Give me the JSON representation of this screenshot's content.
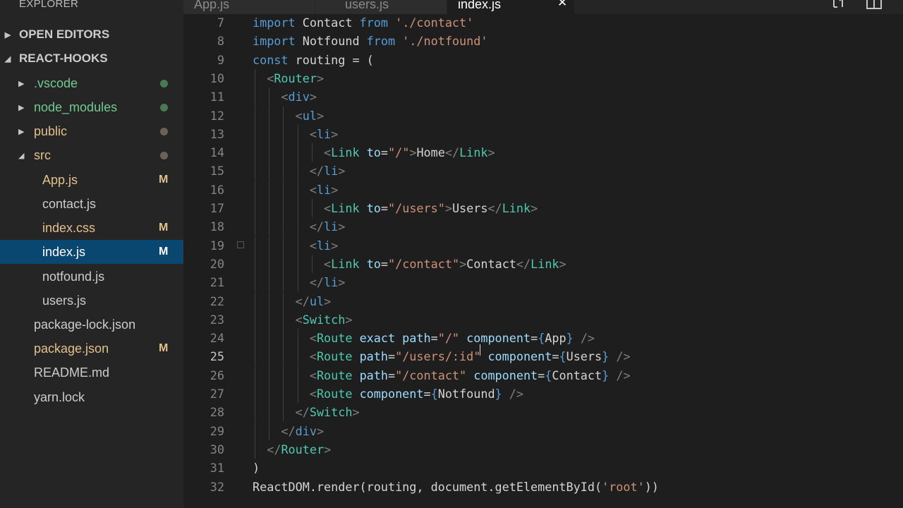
{
  "explorer": {
    "title": "EXPLORER",
    "open_editors": "OPEN EDITORS",
    "project": "REACT-HOOKS",
    "items": [
      {
        "name": ".vscode",
        "kind": "folder",
        "color": "#73c991",
        "status_dot": "#4a7a52"
      },
      {
        "name": "node_modules",
        "kind": "folder",
        "color": "#73c991",
        "status_dot": "#4a7a52"
      },
      {
        "name": "public",
        "kind": "folder",
        "color": "#e2c08d",
        "status_dot": "#6b6256"
      },
      {
        "name": "src",
        "kind": "folder-open",
        "color": "#e2c08d",
        "status_dot": "#6b6256"
      },
      {
        "name": "App.js",
        "kind": "file",
        "color": "#e2c08d",
        "badge": "M"
      },
      {
        "name": "contact.js",
        "kind": "file",
        "color": "#cccccc"
      },
      {
        "name": "index.css",
        "kind": "file",
        "color": "#e2c08d",
        "badge": "M"
      },
      {
        "name": "index.js",
        "kind": "file",
        "color": "#ffffff",
        "badge": "M",
        "selected": true
      },
      {
        "name": "notfound.js",
        "kind": "file",
        "color": "#cccccc"
      },
      {
        "name": "users.js",
        "kind": "file",
        "color": "#cccccc"
      },
      {
        "name": "package-lock.json",
        "kind": "root-file",
        "color": "#cccccc"
      },
      {
        "name": "package.json",
        "kind": "root-file",
        "color": "#e2c08d",
        "badge": "M"
      },
      {
        "name": "README.md",
        "kind": "root-file",
        "color": "#cccccc"
      },
      {
        "name": "yarn.lock",
        "kind": "root-file",
        "color": "#cccccc"
      }
    ]
  },
  "tabs": [
    {
      "label": "App.js",
      "active": false
    },
    {
      "label": "users.js",
      "active": false
    },
    {
      "label": "index.js",
      "active": true,
      "close": "✕"
    }
  ],
  "toolbar_icons": [
    "split-compare-icon",
    "split-editor-icon"
  ],
  "editor": {
    "current_line": 25,
    "lines": [
      {
        "n": "7",
        "tokens": [
          [
            "kw",
            "import "
          ],
          [
            "id",
            "Contact "
          ],
          [
            "kw",
            "from "
          ],
          [
            "str",
            "'./contact'"
          ]
        ]
      },
      {
        "n": "8",
        "tokens": [
          [
            "kw",
            "import "
          ],
          [
            "id",
            "Notfound "
          ],
          [
            "kw",
            "from "
          ],
          [
            "str",
            "'./notfound'"
          ]
        ]
      },
      {
        "n": "9",
        "tokens": [
          [
            "kw",
            "const "
          ],
          [
            "id",
            "routing = ("
          ]
        ]
      },
      {
        "n": "10",
        "tokens": [
          [
            "id",
            "  "
          ],
          [
            "punc",
            "<"
          ],
          [
            "tag",
            "Router"
          ],
          [
            "punc",
            ">"
          ]
        ]
      },
      {
        "n": "11",
        "tokens": [
          [
            "id",
            "    "
          ],
          [
            "punc",
            "<"
          ],
          [
            "tag",
            "div"
          ],
          [
            "punc",
            ">"
          ]
        ]
      },
      {
        "n": "12",
        "tokens": [
          [
            "id",
            "      "
          ],
          [
            "punc",
            "<"
          ],
          [
            "tag",
            "ul"
          ],
          [
            "punc",
            ">"
          ]
        ]
      },
      {
        "n": "13",
        "tokens": [
          [
            "id",
            "        "
          ],
          [
            "punc",
            "<"
          ],
          [
            "tag",
            "li"
          ],
          [
            "punc",
            ">"
          ]
        ]
      },
      {
        "n": "14",
        "tokens": [
          [
            "id",
            "          "
          ],
          [
            "punc",
            "<"
          ],
          [
            "tag",
            "Link "
          ],
          [
            "attr",
            "to"
          ],
          [
            "id",
            "="
          ],
          [
            "str",
            "\"/\""
          ],
          [
            "punc",
            ">"
          ],
          [
            "id",
            "Home"
          ],
          [
            "punc",
            "</"
          ],
          [
            "tag",
            "Link"
          ],
          [
            "punc",
            ">"
          ]
        ]
      },
      {
        "n": "15",
        "tokens": [
          [
            "id",
            "        "
          ],
          [
            "punc",
            "</"
          ],
          [
            "tag",
            "li"
          ],
          [
            "punc",
            ">"
          ]
        ]
      },
      {
        "n": "16",
        "tokens": [
          [
            "id",
            "        "
          ],
          [
            "punc",
            "<"
          ],
          [
            "tag",
            "li"
          ],
          [
            "punc",
            ">"
          ]
        ]
      },
      {
        "n": "17",
        "tokens": [
          [
            "id",
            "          "
          ],
          [
            "punc",
            "<"
          ],
          [
            "tag",
            "Link "
          ],
          [
            "attr",
            "to"
          ],
          [
            "id",
            "="
          ],
          [
            "str",
            "\"/users\""
          ],
          [
            "punc",
            ">"
          ],
          [
            "id",
            "Users"
          ],
          [
            "punc",
            "</"
          ],
          [
            "tag",
            "Link"
          ],
          [
            "punc",
            ">"
          ]
        ]
      },
      {
        "n": "18",
        "tokens": [
          [
            "id",
            "        "
          ],
          [
            "punc",
            "</"
          ],
          [
            "tag",
            "li"
          ],
          [
            "punc",
            ">"
          ]
        ]
      },
      {
        "n": "19",
        "tokens": [
          [
            "id",
            "        "
          ],
          [
            "punc",
            "<"
          ],
          [
            "tag",
            "li"
          ],
          [
            "punc",
            ">"
          ]
        ]
      },
      {
        "n": "20",
        "tokens": [
          [
            "id",
            "          "
          ],
          [
            "punc",
            "<"
          ],
          [
            "tag",
            "Link "
          ],
          [
            "attr",
            "to"
          ],
          [
            "id",
            "="
          ],
          [
            "str",
            "\"/contact\""
          ],
          [
            "punc",
            ">"
          ],
          [
            "id",
            "Contact"
          ],
          [
            "punc",
            "</"
          ],
          [
            "tag",
            "Link"
          ],
          [
            "punc",
            ">"
          ]
        ]
      },
      {
        "n": "21",
        "tokens": [
          [
            "id",
            "        "
          ],
          [
            "punc",
            "</"
          ],
          [
            "tag",
            "li"
          ],
          [
            "punc",
            ">"
          ]
        ]
      },
      {
        "n": "22",
        "tokens": [
          [
            "id",
            "      "
          ],
          [
            "punc",
            "</"
          ],
          [
            "tag",
            "ul"
          ],
          [
            "punc",
            ">"
          ]
        ]
      },
      {
        "n": "23",
        "tokens": [
          [
            "id",
            "      "
          ],
          [
            "punc",
            "<"
          ],
          [
            "tag",
            "Switch"
          ],
          [
            "punc",
            ">"
          ]
        ]
      },
      {
        "n": "24",
        "tokens": [
          [
            "id",
            "        "
          ],
          [
            "punc",
            "<"
          ],
          [
            "tag",
            "Route "
          ],
          [
            "attr",
            "exact path"
          ],
          [
            "id",
            "="
          ],
          [
            "str",
            "\"/\" "
          ],
          [
            "attr",
            "component"
          ],
          [
            "id",
            "="
          ],
          [
            "brace",
            "{"
          ],
          [
            "id",
            "App"
          ],
          [
            "brace",
            "}"
          ],
          [
            "punc",
            " />"
          ]
        ]
      },
      {
        "n": "25",
        "tokens": [
          [
            "id",
            "        "
          ],
          [
            "punc",
            "<"
          ],
          [
            "tag",
            "Route "
          ],
          [
            "attr",
            "path"
          ],
          [
            "id",
            "="
          ],
          [
            "str",
            "\"/users/:id\" "
          ],
          [
            "attr",
            "component"
          ],
          [
            "id",
            "="
          ],
          [
            "brace",
            "{"
          ],
          [
            "id",
            "Users"
          ],
          [
            "brace",
            "}"
          ],
          [
            "punc",
            " />"
          ]
        ]
      },
      {
        "n": "26",
        "tokens": [
          [
            "id",
            "        "
          ],
          [
            "punc",
            "<"
          ],
          [
            "tag",
            "Route "
          ],
          [
            "attr",
            "path"
          ],
          [
            "id",
            "="
          ],
          [
            "str",
            "\"/contact\" "
          ],
          [
            "attr",
            "component"
          ],
          [
            "id",
            "="
          ],
          [
            "brace",
            "{"
          ],
          [
            "id",
            "Contact"
          ],
          [
            "brace",
            "}"
          ],
          [
            "punc",
            " />"
          ]
        ]
      },
      {
        "n": "27",
        "tokens": [
          [
            "id",
            "        "
          ],
          [
            "punc",
            "<"
          ],
          [
            "tag",
            "Route "
          ],
          [
            "attr",
            "component"
          ],
          [
            "id",
            "="
          ],
          [
            "brace",
            "{"
          ],
          [
            "id",
            "Notfound"
          ],
          [
            "brace",
            "}"
          ],
          [
            "punc",
            " />"
          ]
        ]
      },
      {
        "n": "28",
        "tokens": [
          [
            "id",
            "      "
          ],
          [
            "punc",
            "</"
          ],
          [
            "tag",
            "Switch"
          ],
          [
            "punc",
            ">"
          ]
        ]
      },
      {
        "n": "29",
        "tokens": [
          [
            "id",
            "    "
          ],
          [
            "punc",
            "</"
          ],
          [
            "tag",
            "div"
          ],
          [
            "punc",
            ">"
          ]
        ]
      },
      {
        "n": "30",
        "tokens": [
          [
            "id",
            "  "
          ],
          [
            "punc",
            "</"
          ],
          [
            "tag",
            "Router"
          ],
          [
            "punc",
            ">"
          ]
        ]
      },
      {
        "n": "31",
        "tokens": [
          [
            "id",
            ")"
          ]
        ]
      },
      {
        "n": "32",
        "tokens": [
          [
            "id",
            "ReactDOM.render(routing, document.getElementById("
          ],
          [
            "str",
            "'root'"
          ],
          [
            "id",
            "))"
          ]
        ]
      }
    ]
  }
}
